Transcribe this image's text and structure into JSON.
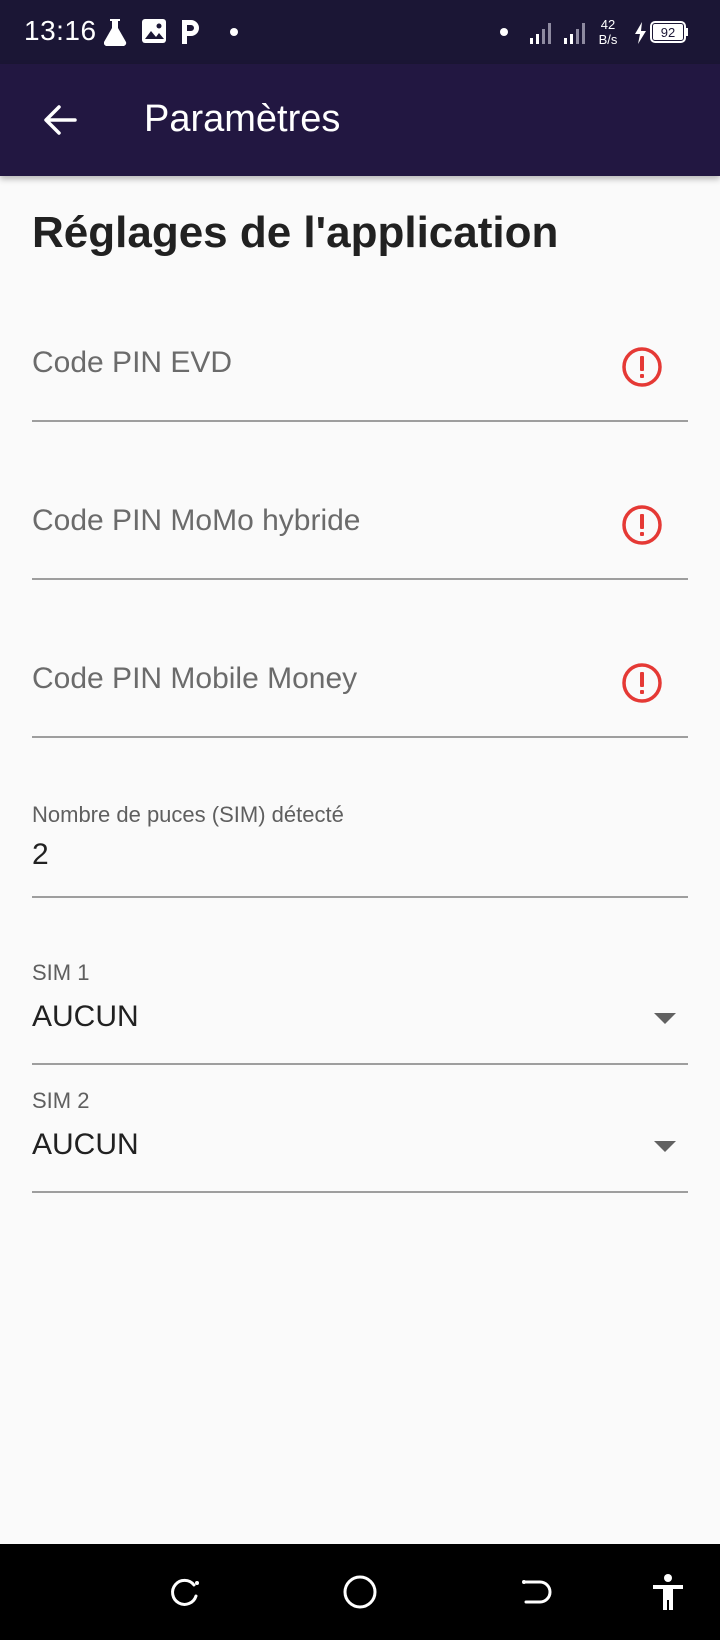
{
  "status_bar": {
    "time": "13:16",
    "network_speed_value": "42",
    "network_speed_unit": "B/s",
    "battery_level": "92",
    "icons": [
      "lab-flask-icon",
      "image-icon",
      "parking-icon",
      "dot-icon",
      "signal-icon",
      "signal-icon",
      "charging-icon",
      "battery-icon"
    ]
  },
  "app_bar": {
    "title": "Paramètres",
    "back_icon": "arrow-left-icon"
  },
  "page": {
    "heading": "Réglages de l'application"
  },
  "fields": {
    "pin_evd": {
      "placeholder": "Code PIN EVD",
      "error_icon": "error-alert-icon"
    },
    "pin_momo_hybrid": {
      "placeholder": "Code PIN MoMo hybride",
      "error_icon": "error-alert-icon"
    },
    "pin_mobile_money": {
      "placeholder": "Code PIN Mobile Money",
      "error_icon": "error-alert-icon"
    },
    "sim_count": {
      "label": "Nombre de puces (SIM) détecté",
      "value": "2"
    },
    "sim1": {
      "label": "SIM 1",
      "value": "AUCUN"
    },
    "sim2": {
      "label": "SIM 2",
      "value": "AUCUN"
    }
  },
  "colors": {
    "status_bar": "#1b1635",
    "app_bar": "#221741",
    "error": "#e53935",
    "background": "#fafafa"
  },
  "nav_bar": {
    "buttons": [
      "recent-apps-icon",
      "home-icon",
      "back-icon",
      "accessibility-icon"
    ]
  }
}
